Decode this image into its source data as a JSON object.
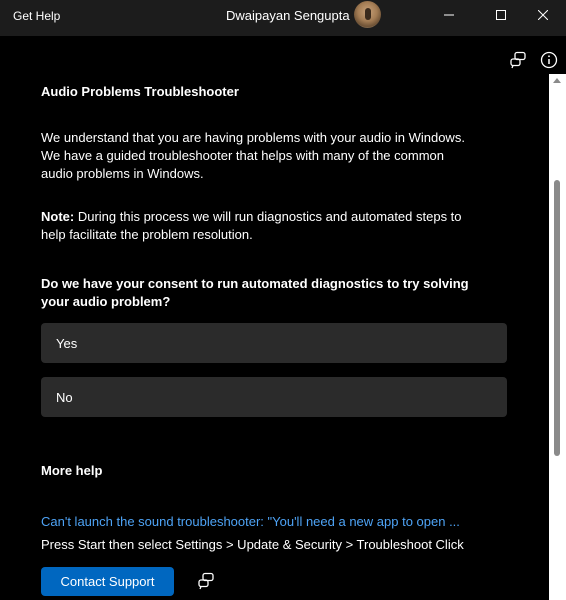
{
  "window": {
    "app_title": "Get Help",
    "user_name": "Dwaipayan Sengupta"
  },
  "toolbar": {
    "feedback_icon": "feedback-icon",
    "info_icon": "info-icon"
  },
  "troubleshooter": {
    "heading": "Audio Problems Troubleshooter",
    "intro": "We understand that you are having problems with your audio in Windows. We have a guided troubleshooter that helps with many of the common audio problems in Windows.",
    "note_label": "Note:",
    "note_text": " During this process we will run diagnostics and automated steps to help facilitate the problem resolution.",
    "question": "Do we have your consent to run automated diagnostics to try solving your audio problem?",
    "options": [
      "Yes",
      "No"
    ]
  },
  "more_help": {
    "heading": "More help",
    "link_text": "Can't launch the sound troubleshooter: \"You'll need a new app to open ...",
    "description": "Press Start then select Settings > Update & Security > Troubleshoot Click",
    "contact_label": "Contact Support"
  },
  "colors": {
    "accent": "#0067c0",
    "link": "#4ea3f5",
    "option_bg": "#2b2b2b"
  }
}
